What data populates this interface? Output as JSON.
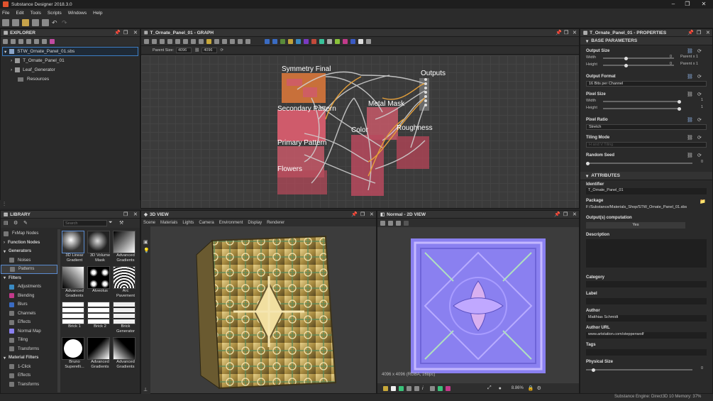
{
  "app": {
    "title": "Substance Designer 2018.3.0"
  },
  "menu": [
    "File",
    "Edit",
    "Tools",
    "Scripts",
    "Windows",
    "Help"
  ],
  "explorer": {
    "title": "EXPLORER",
    "items": [
      {
        "label": "STW_Ornate_Panel_01.sbs"
      },
      {
        "label": "T_Ornate_Panel_01"
      },
      {
        "label": "Leaf_Generator"
      },
      {
        "label": "Resources"
      }
    ]
  },
  "graph": {
    "title": "T_Ornate_Panel_01 - GRAPH",
    "parent_size_label": "Parent Size:",
    "parent_size_value": "4096",
    "size_value": "4096",
    "frames": [
      "Symmetry Final",
      "Outputs",
      "Secondary Pattern",
      "Metal Mask",
      "Color",
      "Roughness",
      "Primary Pattern",
      "Flowers"
    ]
  },
  "properties": {
    "title": "T_Ornate_Panel_01 - PROPERTIES",
    "base_section": "BASE PARAMETERS",
    "output_size": {
      "label": "Output Size",
      "width_label": "Width",
      "height_label": "Height",
      "width_value": "0",
      "height_value": "0",
      "width_suffix": "Parent x 1",
      "height_suffix": "Parent x 1"
    },
    "output_format": {
      "label": "Output Format",
      "value": "16 Bits per Channel"
    },
    "pixel_size": {
      "label": "Pixel Size",
      "width_label": "Width",
      "height_label": "Height",
      "width_value": "1",
      "height_value": "1"
    },
    "pixel_ratio": {
      "label": "Pixel Ratio",
      "value": "Stretch"
    },
    "tiling_mode": {
      "label": "Tiling Mode",
      "value": "H and V Tiling"
    },
    "random_seed": {
      "label": "Random Seed",
      "value": "0"
    },
    "attributes_section": "ATTRIBUTES",
    "identifier": {
      "label": "Identifier",
      "value": "T_Ornate_Panel_01"
    },
    "package": {
      "label": "Package",
      "value": "F:/Substance/Materials_Shop/STW_Ornate_Panel_01.sbs"
    },
    "outputs_computation": {
      "label": "Output(s) computation",
      "value": "Yes"
    },
    "description": {
      "label": "Description"
    },
    "category": {
      "label": "Category"
    },
    "label": {
      "label": "Label"
    },
    "author": {
      "label": "Author",
      "value": "Matthias Schmidt"
    },
    "author_url": {
      "label": "Author URL",
      "value": "www.artstation.com/steppenwolf"
    },
    "tags": {
      "label": "Tags"
    },
    "physical_size": {
      "label": "Physical Size",
      "value": "0"
    }
  },
  "library": {
    "title": "LIBRARY",
    "search_placeholder": "Search",
    "categories": [
      {
        "label": "FxMap Nodes",
        "head": false
      },
      {
        "label": "Function Nodes",
        "head": true
      },
      {
        "label": "Generators",
        "head": true
      },
      {
        "label": "Noises",
        "head": false
      },
      {
        "label": "Patterns",
        "head": false,
        "selected": true
      },
      {
        "label": "Filters",
        "head": true
      },
      {
        "label": "Adjustments",
        "head": false
      },
      {
        "label": "Blending",
        "head": false
      },
      {
        "label": "Blurs",
        "head": false
      },
      {
        "label": "Channels",
        "head": false
      },
      {
        "label": "Effects",
        "head": false
      },
      {
        "label": "Normal Map",
        "head": false
      },
      {
        "label": "Tiling",
        "head": false
      },
      {
        "label": "Transforms",
        "head": false
      },
      {
        "label": "Material Filters",
        "head": true
      },
      {
        "label": "1-Click",
        "head": false
      },
      {
        "label": "Effects",
        "head": false
      },
      {
        "label": "Transforms",
        "head": false
      }
    ],
    "items": [
      {
        "label": "3D Linear Gradient"
      },
      {
        "label": "3D Volume Mask"
      },
      {
        "label": "Advanced Gradients"
      },
      {
        "label": "Advanced Gradients"
      },
      {
        "label": "Alveolus"
      },
      {
        "label": "Arc Pavement"
      },
      {
        "label": "Brick 1"
      },
      {
        "label": "Brick 2"
      },
      {
        "label": "Brick Generator"
      },
      {
        "label": "Bruno Superelli..."
      },
      {
        "label": "Advanced Gradients"
      },
      {
        "label": "Advanced Gradients"
      }
    ]
  },
  "view3d": {
    "title": "3D VIEW",
    "menu": [
      "Scene",
      "Materials",
      "Lights",
      "Camera",
      "Environment",
      "Display",
      "Renderer"
    ]
  },
  "view2d": {
    "title": "Normal - 2D VIEW",
    "info": "4096 x 4096 (RGBA, 16bpc)",
    "zoom": "8.86%"
  },
  "status": {
    "text": "Substance Engine: Direct3D 10  Memory: 37%"
  },
  "colors": {
    "accent": "#3d7ec5",
    "node_red": "#cf5b6b",
    "frame_orange": "#d27a3a",
    "normal_map": "#8a80f0"
  }
}
